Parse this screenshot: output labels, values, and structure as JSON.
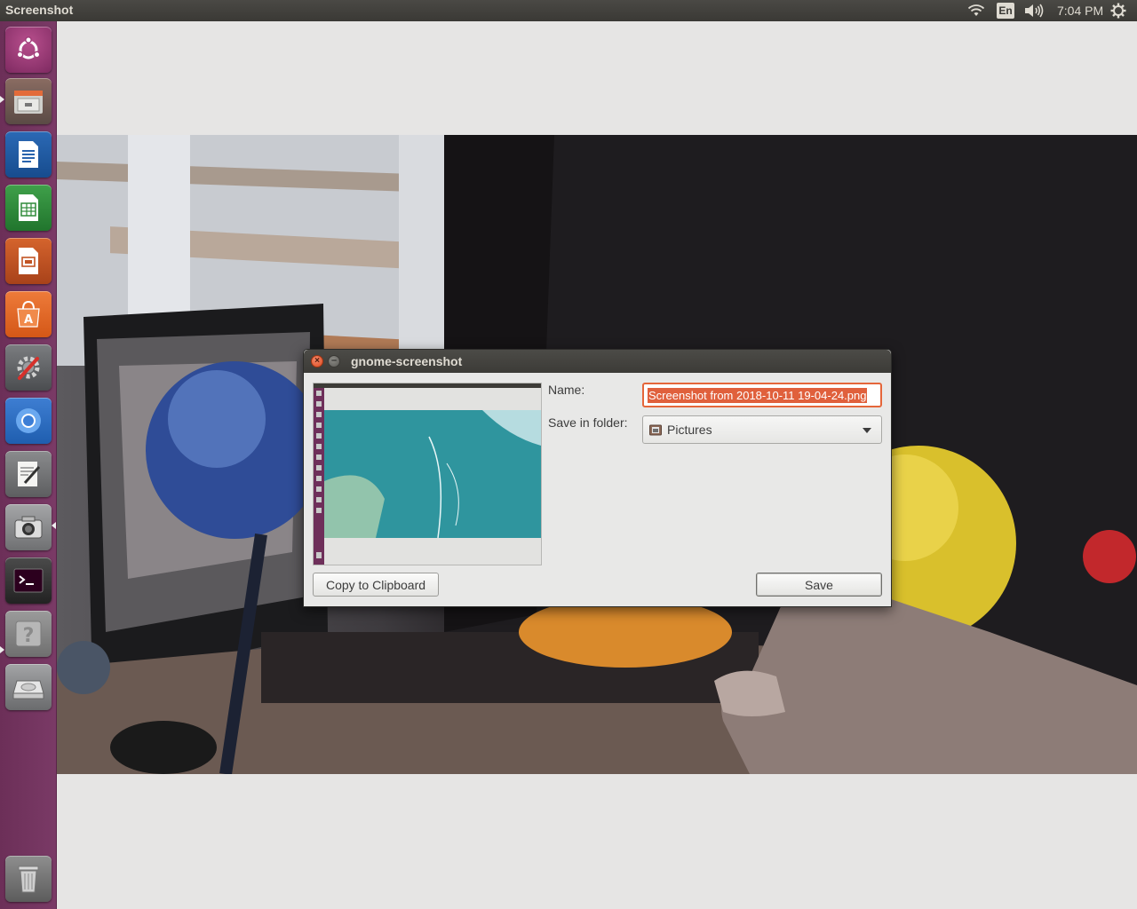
{
  "top_panel": {
    "app_title": "Screenshot",
    "keyboard_layout": "En",
    "clock": "7:04 PM",
    "icons": [
      "wifi-icon",
      "keyboard-layout-indicator",
      "sound-icon",
      "session-gear-icon"
    ]
  },
  "launcher": {
    "items": [
      {
        "name": "ubuntu-dash",
        "icon": "ubuntu-logo-icon"
      },
      {
        "name": "files",
        "icon": "file-manager-icon"
      },
      {
        "name": "libreoffice-writer",
        "icon": "writer-icon"
      },
      {
        "name": "libreoffice-calc",
        "icon": "calc-icon"
      },
      {
        "name": "libreoffice-impress",
        "icon": "impress-icon"
      },
      {
        "name": "ubuntu-software",
        "icon": "software-center-icon"
      },
      {
        "name": "system-settings",
        "icon": "settings-icon"
      },
      {
        "name": "chromium",
        "icon": "chromium-icon"
      },
      {
        "name": "text-editor",
        "icon": "text-editor-icon"
      },
      {
        "name": "screenshot",
        "icon": "camera-icon"
      },
      {
        "name": "terminal",
        "icon": "terminal-icon"
      },
      {
        "name": "help",
        "icon": "help-icon"
      },
      {
        "name": "disk",
        "icon": "drive-icon"
      },
      {
        "name": "trash",
        "icon": "trash-icon"
      }
    ]
  },
  "dialog": {
    "title": "gnome-screenshot",
    "name_label": "Name:",
    "name_value": "Screenshot from 2018-10-11 19-04-24.png",
    "folder_label": "Save in folder:",
    "folder_value": "Pictures",
    "copy_button": "Copy to Clipboard",
    "save_button": "Save"
  },
  "colors": {
    "panel": "#3c3b37",
    "launcher": "#74345f",
    "accent": "#e0603c",
    "dialog_bg": "#e8e8e7"
  }
}
